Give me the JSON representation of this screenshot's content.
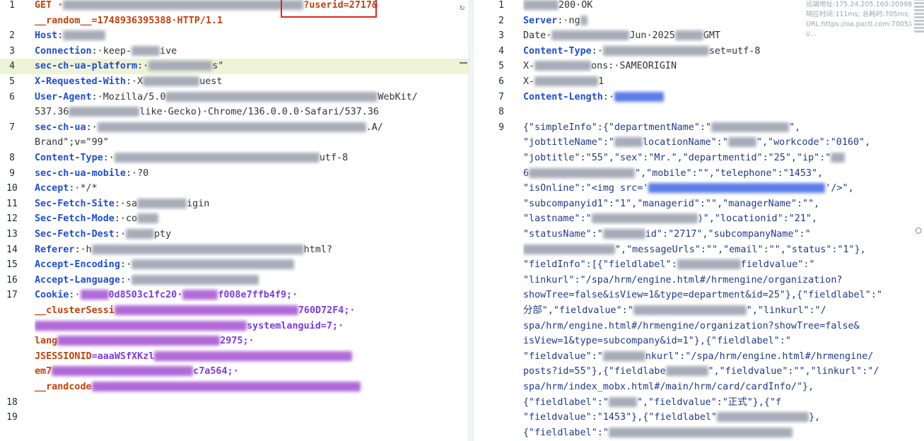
{
  "request": {
    "lines": [
      {
        "n": "1",
        "t": "GET ·",
        "tail": "?userid=2717&"
      },
      {
        "n": "",
        "t": "__random__=1748936395388·HTTP/1.1"
      },
      {
        "n": "2",
        "k": "Host",
        "t": ":"
      },
      {
        "n": "3",
        "k": "Connection",
        "t": ":·keep-",
        "tail": "ive"
      },
      {
        "n": "4",
        "k": "sec-ch-ua-platform",
        "t": ":·",
        "tail": "s\""
      },
      {
        "n": "5",
        "k": "X-Requested-With",
        "t": ":·X",
        "tail": "uest"
      },
      {
        "n": "6",
        "k": "User-Agent",
        "t": ":·Mozilla/5.0",
        "tail": "WebKit/"
      },
      {
        "n": "",
        "t": "537.36",
        "tail": "like·Gecko)·Chrome/136.0.0.0·Safari/537.36"
      },
      {
        "n": "7",
        "k": "sec-ch-ua",
        "t": ":·",
        "tail": ".A/"
      },
      {
        "n": "",
        "t": "Brand\";v=\"99\""
      },
      {
        "n": "8",
        "k": "Content-Type",
        "t": ":·",
        "tail": "utf-8"
      },
      {
        "n": "9",
        "k": "sec-ch-ua-mobile",
        "t": ":·?0"
      },
      {
        "n": "10",
        "k": "Accept",
        "t": ":·*/*"
      },
      {
        "n": "11",
        "k": "Sec-Fetch-Site",
        "t": ":·sa",
        "tail": "igin"
      },
      {
        "n": "12",
        "k": "Sec-Fetch-Mode",
        "t": ":·co"
      },
      {
        "n": "13",
        "k": "Sec-Fetch-Dest",
        "t": ":·",
        "tail": "pty"
      },
      {
        "n": "14",
        "k": "Referer",
        "t": ":·h",
        "tail": "html?"
      },
      {
        "n": "15",
        "k": "Accept-Encoding",
        "t": ":·"
      },
      {
        "n": "16",
        "k": "Accept-Language",
        "t": ":·"
      },
      {
        "n": "17",
        "k": "Cookie",
        "t": ":·",
        "tail": "0d8503c1fc20·",
        "tail2": "f008e7ffb4f9;·"
      },
      {
        "n": "",
        "ck": "__clusterSessi",
        "tail": "760D72F4;·"
      },
      {
        "n": "",
        "ck": "",
        "tail": "systemlanguid=7;·"
      },
      {
        "n": "",
        "ck": "lang",
        "tail": "2975;·"
      },
      {
        "n": "",
        "ck": "JSESSIONID",
        "t": "=aaaWSfXKzl",
        "tail": ""
      },
      {
        "n": "",
        "ck": "em7",
        "tail": "c7a564;·"
      },
      {
        "n": "",
        "ck": "__randcode",
        "tail": ""
      },
      {
        "n": "18",
        "t": ""
      },
      {
        "n": "19",
        "t": ""
      }
    ]
  },
  "response": {
    "lines": [
      {
        "n": "1",
        "t": "",
        "tail": "200·OK"
      },
      {
        "n": "2",
        "k": "Server",
        "t": ":·ng",
        "tail": ""
      },
      {
        "n": "3",
        "k0": "Date",
        "t": "·",
        "tail": "Jun·2025",
        "tail2": "GMT"
      },
      {
        "n": "4",
        "k": "Content-Type",
        "t": ":·",
        "tail": "set=utf-8"
      },
      {
        "n": "5",
        "k0": "X-",
        "t": "",
        "tail": "ons:·SAMEORIGIN"
      },
      {
        "n": "6",
        "k0": "X-",
        "t": "",
        "tail": "1"
      },
      {
        "n": "7",
        "k": "Content-Length",
        "t": ":·"
      },
      {
        "n": "8",
        "t": ""
      },
      {
        "n": "9",
        "t": "{\"simpleInfo\":{\"departmentName\":\"",
        "tail": "\","
      },
      {
        "n": "",
        "t": "\"jobtitleName\":\"",
        "tail": "locationName\":\"",
        "tail2": "\",\"workcode\":\"0160\","
      },
      {
        "n": "",
        "t": "\"jobtitle\":\"55\",\"sex\":\"Mr.\",\"departmentid\":\"25\",\"ip\":\""
      },
      {
        "n": "",
        "t": "6",
        "tail": "\",\"mobile\":\"\",\"telephone\":\"1453\","
      },
      {
        "n": "",
        "t": "\"isOnline\":\"<img src='",
        "tail": "'/>\","
      },
      {
        "n": "",
        "t": "\"subcompanyid1\":\"1\",\"managerid\":\"\",\"managerName\":\"\","
      },
      {
        "n": "",
        "t": "\"lastname\":\"",
        "tail": ")\",\"locationid\":\"21\","
      },
      {
        "n": "",
        "t": "\"statusName\":\"",
        "tail": "id\":\"2717\",\"subcompanyName\":\""
      },
      {
        "n": "",
        "t": "",
        "tail": "\",\"messageUrls\":\"\",\"email\":\"\",\"status\":\"1\"},"
      },
      {
        "n": "",
        "t": "\"fieldInfo\":[{\"fieldlabel\":",
        "tail": "fieldvalue\":\""
      },
      {
        "n": "",
        "t": "\"linkurl\":\"/spa/hrm/engine.html#/hrmengine/organization?"
      },
      {
        "n": "",
        "t": "showTree=false&isView=1&type=department&id=25\"},{\"fieldlabel\":\""
      },
      {
        "n": "",
        "t": "分部\",\"fieldvalue\":\"",
        "tail": "\",\"linkurl\":\"/"
      },
      {
        "n": "",
        "t": "spa/hrm/engine.html#/hrmengine/organization?showTree=false&"
      },
      {
        "n": "",
        "t": "isView=1&type=subcompany&id=1\"},{\"fieldlabel\":\""
      },
      {
        "n": "",
        "t": "\"fieldvalue\":\"",
        "tail": "nkurl\":\"/spa/hrm/engine.html#/hrmengine/"
      },
      {
        "n": "",
        "t": "posts?id=55\"},{\"fieldlabe",
        "tail": "\",\"fieldvalue\":\"\",\"linkurl\":\"/"
      },
      {
        "n": "",
        "t": "spa/hrm/index_mobx.html#/main/hrm/card/cardInfo/\"},"
      },
      {
        "n": "",
        "t": "{\"fieldlabel\":\"",
        "tail": "\",\"fieldvalue\":\"正式\"},{\"f"
      },
      {
        "n": "",
        "t": "\"fieldvalue\":\"1453\"},{\"fieldlabel\"",
        "tail": "},"
      },
      {
        "n": "",
        "t": "{\"fieldlabel\":\"",
        "tail": ""
      }
    ]
  },
  "info_panel": {
    "remote_addr": "远端地址:175.24.205.160:20998;",
    "timing": "响应时间:111ms; 总耗时:705ms;",
    "url": "URL:https://oa.pactl.com:7005/ap",
    "ellipsis": "i/..."
  },
  "colors": {
    "header_key": "#1d4ed8",
    "cookie_key": "#c2410c",
    "cookie_value": "#7c3aed",
    "highlight_bg": "#eef3d6",
    "annotation_box": "#dc2626"
  },
  "icons": {
    "refresh": "refresh-icon",
    "side_handle": "drag-handle-icon"
  }
}
